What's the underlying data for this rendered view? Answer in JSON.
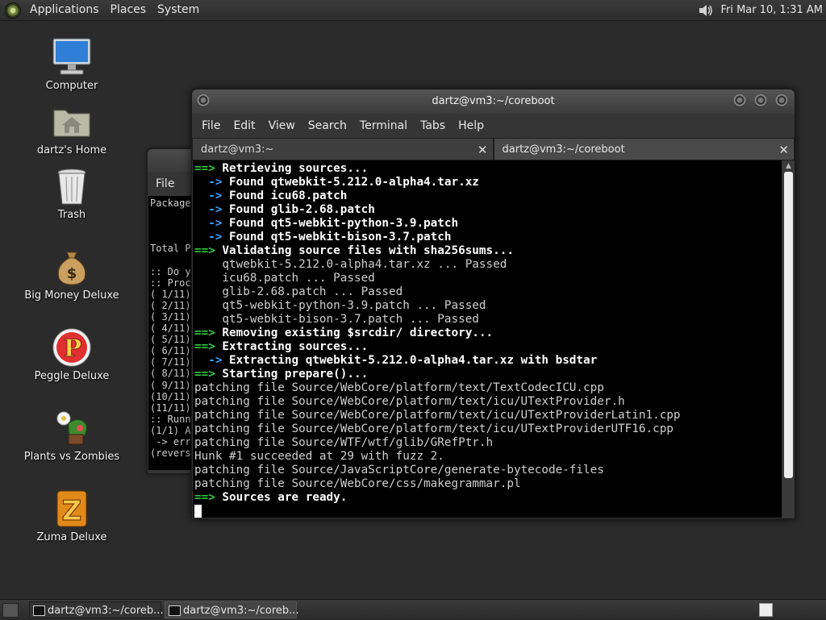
{
  "top_panel": {
    "menus": [
      "Applications",
      "Places",
      "System"
    ],
    "clock": "Fri Mar 10,  1:31 AM"
  },
  "desktop_icons": [
    {
      "label": "Computer"
    },
    {
      "label": "dartz's Home"
    },
    {
      "label": "Trash"
    },
    {
      "label": "Big Money Deluxe"
    },
    {
      "label": "Peggle Deluxe"
    },
    {
      "label": "Plants vs Zombies"
    },
    {
      "label": "Zuma Deluxe"
    }
  ],
  "bg_window": {
    "menu_label": "File",
    "lines": [
      "Package",
      "",
      "",
      "",
      "Total P",
      "",
      ":: Do y",
      ":: Proc",
      "( 1/11)",
      "( 2/11)",
      "( 3/11)",
      "( 4/11)",
      "( 5/11)",
      "( 6/11)",
      "( 7/11)",
      "( 8/11)",
      "( 9/11)",
      "(10/11)",
      "(11/11)",
      ":: Runn",
      "(1/1) A",
      " -> err",
      "(revers"
    ]
  },
  "window": {
    "title": "dartz@vm3:~/coreboot",
    "menu": [
      "File",
      "Edit",
      "View",
      "Search",
      "Terminal",
      "Tabs",
      "Help"
    ],
    "tabs": [
      {
        "label": "dartz@vm3:~",
        "close": "✕"
      },
      {
        "label": "dartz@vm3:~/coreboot",
        "close": "✕"
      }
    ]
  },
  "terminal": {
    "lines": [
      {
        "p": "==>",
        "pc": "g",
        "t": " Retrieving sources...",
        "s": "bold"
      },
      {
        "p": "  ->",
        "pc": "b",
        "t": " Found qtwebkit-5.212.0-alpha4.tar.xz",
        "s": "bold"
      },
      {
        "p": "  ->",
        "pc": "b",
        "t": " Found icu68.patch",
        "s": "bold"
      },
      {
        "p": "  ->",
        "pc": "b",
        "t": " Found glib-2.68.patch",
        "s": "bold"
      },
      {
        "p": "  ->",
        "pc": "b",
        "t": " Found qt5-webkit-python-3.9.patch",
        "s": "bold"
      },
      {
        "p": "  ->",
        "pc": "b",
        "t": " Found qt5-webkit-bison-3.7.patch",
        "s": "bold"
      },
      {
        "p": "==>",
        "pc": "g",
        "t": " Validating source files with sha256sums...",
        "s": "bold"
      },
      {
        "p": "",
        "pc": "",
        "t": "    qtwebkit-5.212.0-alpha4.tar.xz ... Passed",
        "s": "plain"
      },
      {
        "p": "",
        "pc": "",
        "t": "    icu68.patch ... Passed",
        "s": "plain"
      },
      {
        "p": "",
        "pc": "",
        "t": "    glib-2.68.patch ... Passed",
        "s": "plain"
      },
      {
        "p": "",
        "pc": "",
        "t": "    qt5-webkit-python-3.9.patch ... Passed",
        "s": "plain"
      },
      {
        "p": "",
        "pc": "",
        "t": "    qt5-webkit-bison-3.7.patch ... Passed",
        "s": "plain"
      },
      {
        "p": "==>",
        "pc": "g",
        "t": " Removing existing $srcdir/ directory...",
        "s": "bold"
      },
      {
        "p": "==>",
        "pc": "g",
        "t": " Extracting sources...",
        "s": "bold"
      },
      {
        "p": "  ->",
        "pc": "b",
        "t": " Extracting qtwebkit-5.212.0-alpha4.tar.xz with bsdtar",
        "s": "bold"
      },
      {
        "p": "==>",
        "pc": "g",
        "t": " Starting prepare()...",
        "s": "bold"
      },
      {
        "p": "",
        "pc": "",
        "t": "patching file Source/WebCore/platform/text/TextCodecICU.cpp",
        "s": "plain"
      },
      {
        "p": "",
        "pc": "",
        "t": "patching file Source/WebCore/platform/text/icu/UTextProvider.h",
        "s": "plain"
      },
      {
        "p": "",
        "pc": "",
        "t": "patching file Source/WebCore/platform/text/icu/UTextProviderLatin1.cpp",
        "s": "plain"
      },
      {
        "p": "",
        "pc": "",
        "t": "patching file Source/WebCore/platform/text/icu/UTextProviderUTF16.cpp",
        "s": "plain"
      },
      {
        "p": "",
        "pc": "",
        "t": "patching file Source/WTF/wtf/glib/GRefPtr.h",
        "s": "plain"
      },
      {
        "p": "",
        "pc": "",
        "t": "Hunk #1 succeeded at 29 with fuzz 2.",
        "s": "plain"
      },
      {
        "p": "",
        "pc": "",
        "t": "patching file Source/JavaScriptCore/generate-bytecode-files",
        "s": "plain"
      },
      {
        "p": "",
        "pc": "",
        "t": "patching file Source/WebCore/css/makegrammar.pl",
        "s": "plain"
      },
      {
        "p": "==>",
        "pc": "g",
        "t": " Sources are ready.",
        "s": "bold"
      }
    ]
  },
  "taskbar": {
    "tasks": [
      {
        "label": "dartz@vm3:~/coreb..."
      },
      {
        "label": "dartz@vm3:~/coreb..."
      }
    ]
  },
  "colors": {
    "arrow_blue": "#3aa3ff",
    "arrow_green": "#2ecc40"
  }
}
